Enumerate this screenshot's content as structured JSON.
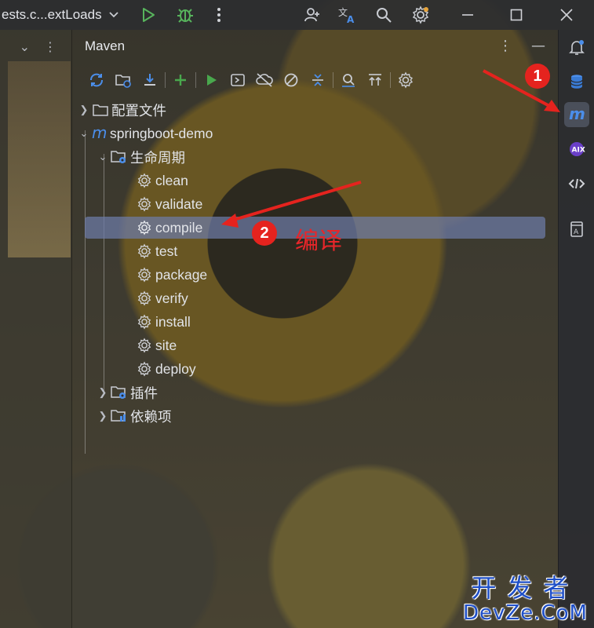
{
  "window": {
    "title": "ests.c...extLoads",
    "title_chevron_icon": "chevron-down-icon"
  },
  "maven_panel": {
    "title": "Maven",
    "tree": {
      "config_files": "配置文件",
      "project": "springboot-demo",
      "lifecycle": "生命周期",
      "phases": [
        "clean",
        "validate",
        "compile",
        "test",
        "package",
        "verify",
        "install",
        "site",
        "deploy"
      ],
      "selected_phase": "compile",
      "plugins": "插件",
      "dependencies": "依赖项"
    }
  },
  "annotations": {
    "badge1": "1",
    "badge2": "2",
    "compile_note": "编译"
  },
  "watermark": {
    "line1": "开发者",
    "line2": "DevZe.CoM"
  },
  "colors": {
    "selection": "#6e7ca8",
    "maven_blue": "#4b8eea",
    "run_green": "#49a84d",
    "annotation_red": "#e5231e",
    "watermark_blue": "#1f4fc7"
  }
}
